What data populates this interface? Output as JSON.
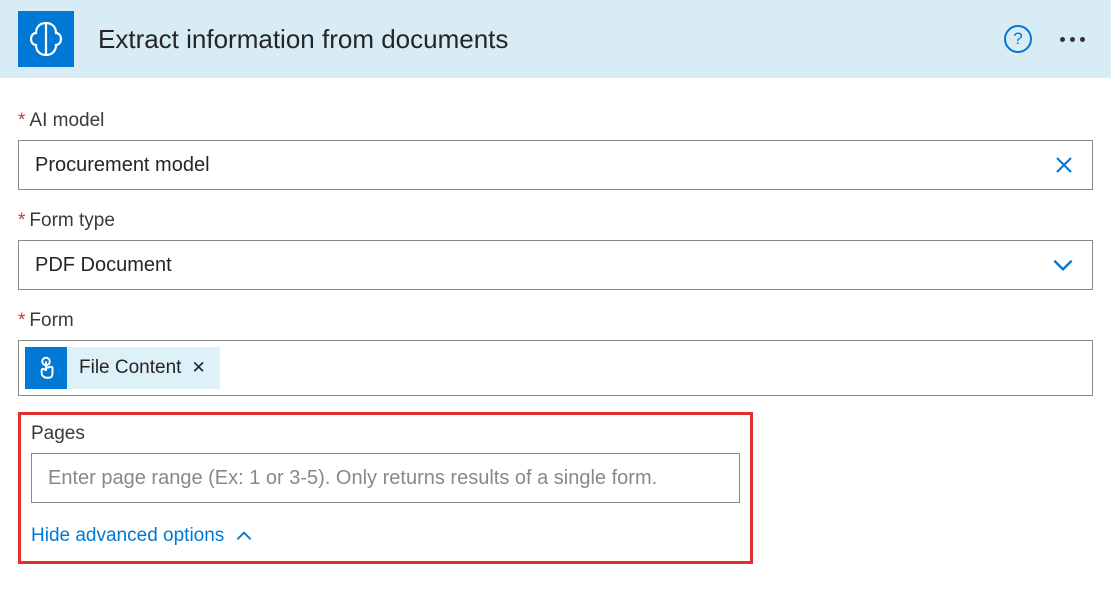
{
  "header": {
    "title": "Extract information from documents"
  },
  "fields": {
    "ai_model": {
      "label": "AI model",
      "value": "Procurement model"
    },
    "form_type": {
      "label": "Form type",
      "value": "PDF Document"
    },
    "form": {
      "label": "Form",
      "token_label": "File Content"
    },
    "pages": {
      "label": "Pages",
      "placeholder": "Enter page range (Ex: 1 or 3-5). Only returns results of a single form."
    }
  },
  "advanced_toggle_label": "Hide advanced options"
}
